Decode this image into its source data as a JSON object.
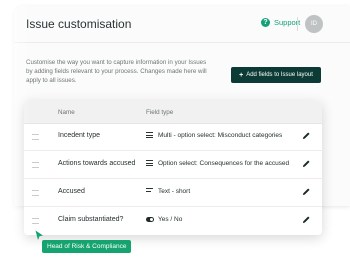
{
  "header": {
    "title": "Issue customisation",
    "support_label": "Support",
    "avatar_initials": "ID"
  },
  "intro": {
    "description": "Customise the way you want to capture information in your Issues by adding fields relevant to your process. Changes made here will apply to all issues.",
    "add_fields_label": "Add fields to Issue layout"
  },
  "table": {
    "columns": {
      "name": "Name",
      "type": "Field type"
    },
    "rows": [
      {
        "name": "Incedent type",
        "type": "Multi - option select: Misconduct categories",
        "icon": "list-icon"
      },
      {
        "name": "Actions towards accused",
        "type": "Option select: Consequences for the accused",
        "icon": "list-icon"
      },
      {
        "name": "Accused",
        "type": "Text - short",
        "icon": "text-icon"
      },
      {
        "name": "Claim substantiated?",
        "type": "Yes / No",
        "icon": "toggle-icon"
      }
    ]
  },
  "cursor_tag": {
    "label": "Head of Risk & Compliance"
  },
  "colors": {
    "accent": "#13a07a",
    "primary_button": "#0c3b36",
    "tag": "#15a36f"
  }
}
